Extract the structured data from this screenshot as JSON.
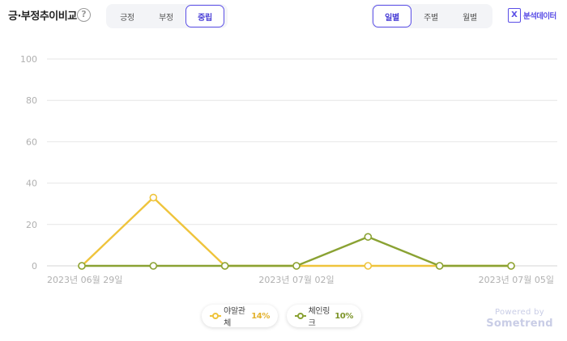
{
  "header": {
    "title": "긍·부정추이비교",
    "help_icon": "?"
  },
  "sentiment_tabs": [
    {
      "label": "긍정",
      "active": false
    },
    {
      "label": "부정",
      "active": false
    },
    {
      "label": "중립",
      "active": true
    }
  ],
  "period_tabs": [
    {
      "label": "일별",
      "active": true
    },
    {
      "label": "주별",
      "active": false
    },
    {
      "label": "월별",
      "active": false
    }
  ],
  "export": {
    "icon": "excel-icon",
    "icon_glyph": "X",
    "label": "분석데이터"
  },
  "colors": {
    "accent": "#5a4ee6",
    "series1": "#efc43c",
    "series2": "#8aa233",
    "grid": "#e6e6e6"
  },
  "chart_data": {
    "type": "line",
    "title": "",
    "xlabel": "",
    "ylabel": "",
    "ylim": [
      0,
      100
    ],
    "yticks": [
      0,
      20,
      40,
      60,
      80,
      100
    ],
    "x": [
      "2023-06-29",
      "2023-06-30",
      "2023-07-01",
      "2023-07-02",
      "2023-07-03",
      "2023-07-04",
      "2023-07-05"
    ],
    "x_tick_labels": [
      {
        "index": 0,
        "label": "2023년 06월 29일"
      },
      {
        "index": 3,
        "label": "2023년 07월 02일"
      },
      {
        "index": 6,
        "label": "2023년 07월 05일"
      }
    ],
    "series": [
      {
        "name": "야알관체",
        "share": "14%",
        "color": "#efc43c",
        "values": [
          0,
          33,
          0,
          0,
          0,
          0,
          0
        ]
      },
      {
        "name": "체인링크",
        "share": "10%",
        "color": "#8aa233",
        "values": [
          0,
          0,
          0,
          0,
          14,
          0,
          0
        ]
      }
    ],
    "grid": true,
    "legend_position": "bottom-center"
  },
  "watermark": {
    "line1": "Powered by",
    "line2": "Sometrend"
  }
}
